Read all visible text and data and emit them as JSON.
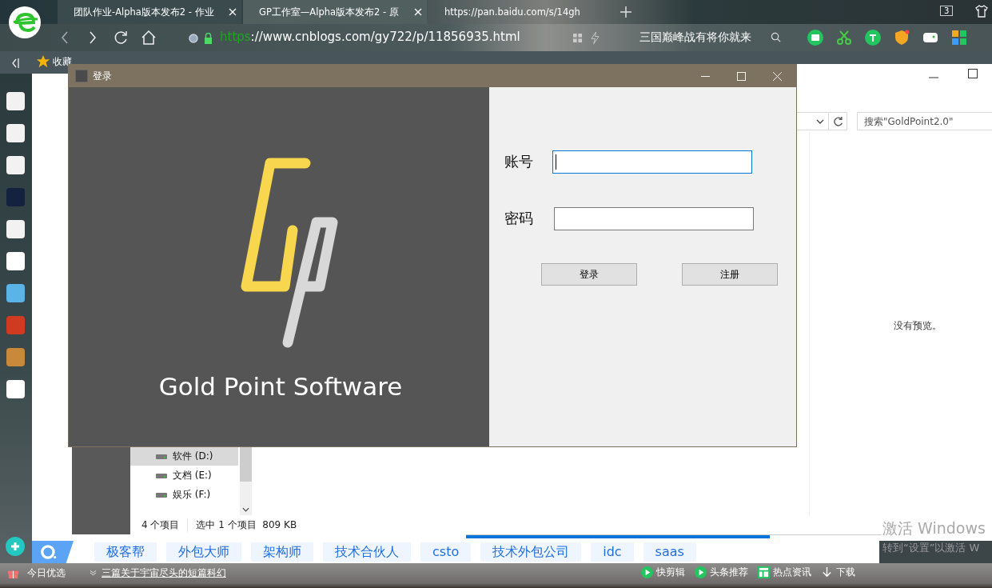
{
  "browser": {
    "tabs": [
      {
        "title": "团队作业-Alpha版本发布2 - 作业",
        "selected": false
      },
      {
        "title": "GP工作室—Alpha版本发布2 - 原",
        "selected": true
      },
      {
        "title": "https://pan.baidu.com/s/14gh",
        "selected": false
      }
    ],
    "tab_count": "3",
    "address": {
      "scheme": "https",
      "rest": "://www.cnblogs.com/gy722/p/11856935.html"
    },
    "search_hint": "三国巅峰战有将你就来",
    "bookmark": "收藏"
  },
  "explorer": {
    "search_placeholder": "搜索\"GoldPoint2.0\"",
    "drives": [
      {
        "label": "软件 (D:)",
        "selected": true
      },
      {
        "label": "文档 (E:)",
        "selected": false
      },
      {
        "label": "娱乐 (F:)",
        "selected": false
      }
    ],
    "status": [
      "4 个项目",
      "选中 1 个项目  809 KB"
    ],
    "preview": "没有预览。"
  },
  "login": {
    "title": "登录",
    "logo_text": "Gold Point Software",
    "fields": [
      {
        "label": "账号",
        "focused": true
      },
      {
        "label": "密码",
        "focused": false
      }
    ],
    "buttons": [
      "登录",
      "注册"
    ]
  },
  "page_progress": {
    "level": 0.73
  },
  "tags": [
    "极客帮",
    "外包大师",
    "架构师",
    "技术合伙人",
    "csto",
    "技术外包公司",
    "idc",
    "saas"
  ],
  "bottom_bar": {
    "label": "今日优选",
    "headline": "三篇关于宇宙尽头的短篇科幻",
    "items": [
      "快剪辑",
      "头条推荐",
      "热点资讯",
      "下载"
    ]
  },
  "activation": {
    "title": "激活 Windows",
    "hint": "转到“设置”以激活 W"
  }
}
